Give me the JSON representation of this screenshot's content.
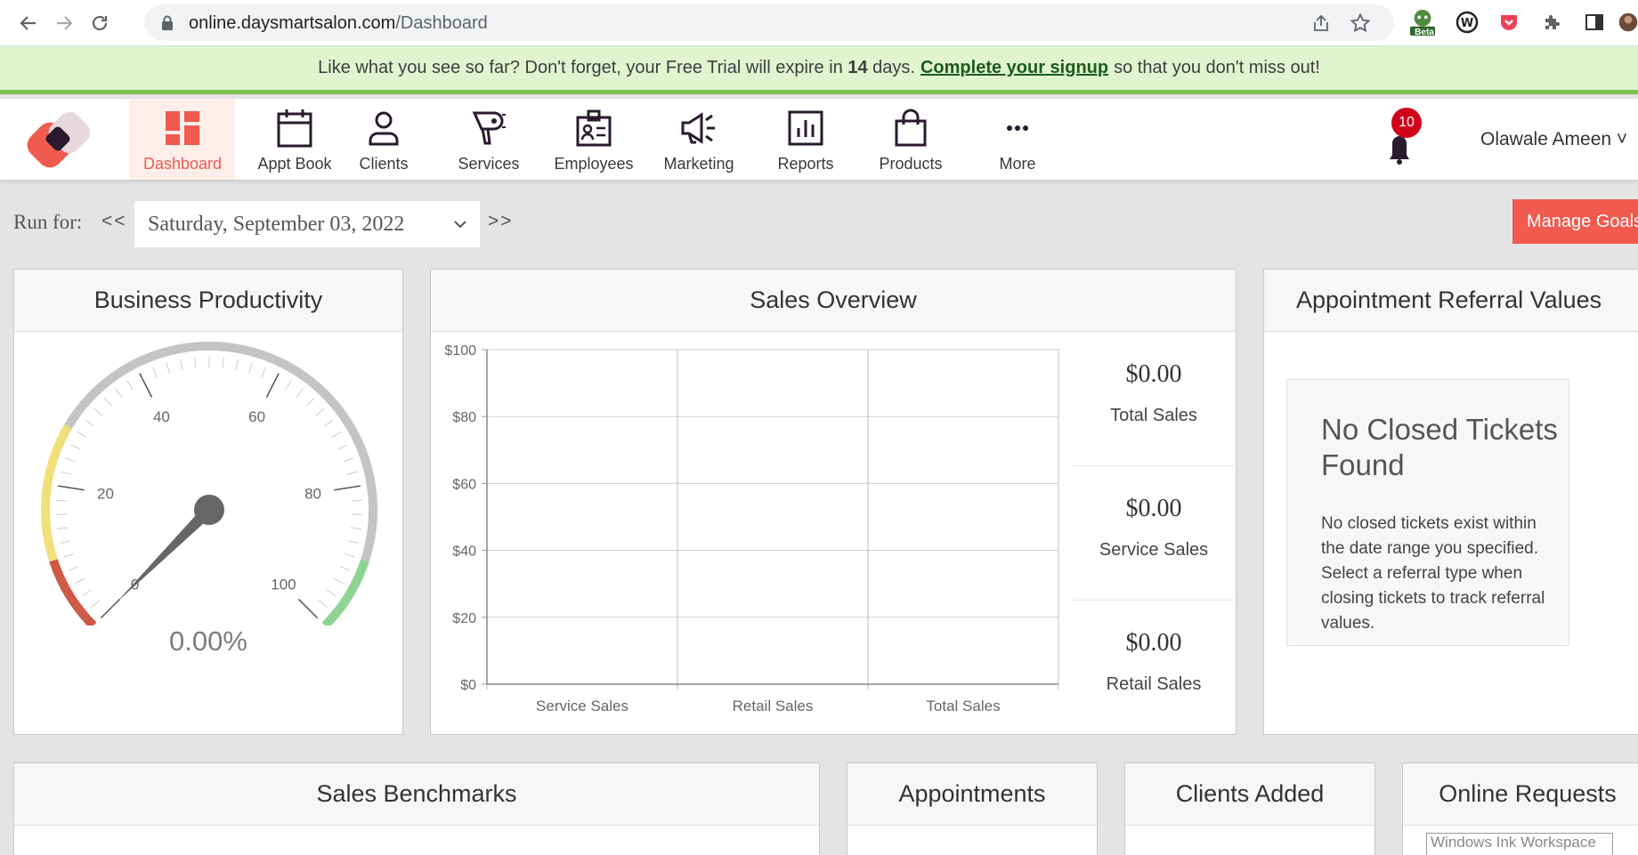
{
  "browser": {
    "url_host": "online.daysmartsalon.com",
    "url_path": "/Dashboard",
    "ext_badge": "Beta",
    "icons": [
      "back-icon",
      "forward-icon",
      "reload-icon",
      "lock-icon",
      "share-icon",
      "star-icon",
      "extension-icon",
      "puzzle-icon",
      "sidepanel-icon",
      "avatar"
    ]
  },
  "banner": {
    "text_before": "Like what you see so far? Don't forget, your Free Trial will expire in",
    "days": "14",
    "text_days": "days.",
    "link": "Complete your signup",
    "text_after": "so that you don't miss out!",
    "bg": "#dff4cf",
    "border": "#7cc24e"
  },
  "nav": {
    "items": [
      {
        "label": "Dashboard",
        "icon": "dashboard-icon",
        "active": true
      },
      {
        "label": "Appt Book",
        "icon": "calendar-icon"
      },
      {
        "label": "Clients",
        "icon": "person-icon"
      },
      {
        "label": "Services",
        "icon": "hair-dryer-icon"
      },
      {
        "label": "Employees",
        "icon": "id-badge-icon"
      },
      {
        "label": "Marketing",
        "icon": "megaphone-icon"
      },
      {
        "label": "Reports",
        "icon": "bar-chart-icon"
      },
      {
        "label": "Products",
        "icon": "shopping-bag-icon"
      },
      {
        "label": "More",
        "icon": "more-icon"
      }
    ],
    "notifications": "10",
    "user": "Olawale Ameen",
    "accent": "#f05a4f"
  },
  "runfor": {
    "label": "Run for:",
    "prev": "<<",
    "next": ">>",
    "date": "Saturday, September 03, 2022",
    "manage_goals": "Manage Goals"
  },
  "panels": {
    "productivity": {
      "title": "Business Productivity",
      "value": "0.00%",
      "ticks": [
        "0",
        "20",
        "40",
        "60",
        "80",
        "100"
      ],
      "needle_value": 0
    },
    "sales": {
      "title": "Sales Overview",
      "stats": [
        {
          "value": "$0.00",
          "label": "Total Sales"
        },
        {
          "value": "$0.00",
          "label": "Service Sales"
        },
        {
          "value": "$0.00",
          "label": "Retail Sales"
        }
      ]
    },
    "referral": {
      "title": "Appointment Referral Values",
      "empty_title": "No Closed Tickets Found",
      "empty_text": "No closed tickets exist within the date range you specified. Select a referral type when closing tickets to track referral values."
    },
    "benchmarks": {
      "title": "Sales Benchmarks"
    },
    "appointments": {
      "title": "Appointments"
    },
    "clients_added": {
      "title": "Clients Added"
    },
    "online_requests": {
      "title": "Online Requests"
    }
  },
  "chart_data": {
    "type": "bar",
    "categories": [
      "Service Sales",
      "Retail Sales",
      "Total Sales"
    ],
    "values": [
      0,
      0,
      0
    ],
    "yticks": [
      "$0",
      "$20",
      "$40",
      "$60",
      "$80",
      "$100"
    ],
    "ylim": [
      0,
      100
    ],
    "grid": true
  },
  "overlay": {
    "ink_tip": "Windows Ink Workspace"
  }
}
